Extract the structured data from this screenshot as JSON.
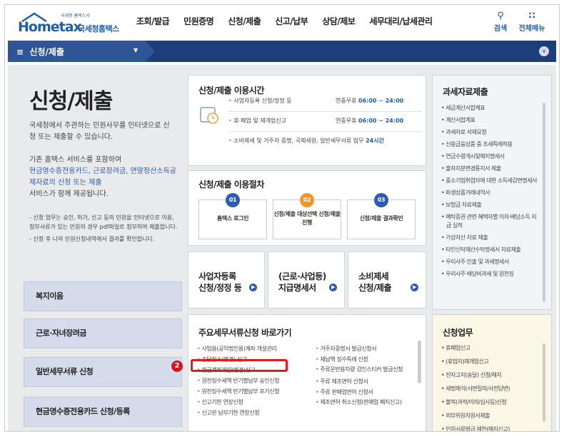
{
  "logo": {
    "text": "Hometax",
    "korean": "국세청홈택스",
    "tiny": "국세청 홈택스서"
  },
  "nav": [
    "조회/발급",
    "민원증명",
    "신청/제출",
    "신고/납부",
    "상담/제보",
    "세무대리/납세관리"
  ],
  "top_icons": {
    "search_label": "검색",
    "menu_label": "전체메뉴"
  },
  "subbar": {
    "label": "신청/제출"
  },
  "intro": {
    "title": "신청/제출",
    "p1": "국세청에서 주관하는 민원사무를 인터넷으로 신청 또는 제출할 수 있습니다.",
    "p2_a": "기존 홈택스 서비스를 포함하여",
    "p2_blue": "현금영수증전용카드, 근로장려금, 연말정산소득공제자료의 신청 또는 제출",
    "p2_b": "서비스가 함께 제공됩니다.",
    "note1": "- 신청 업무는 승인, 허가, 신고 등의 민원을 인터넷으로 이용, 첨부서류가 있는 민원의 경우 pdf파일로 첨부하여 제출합니다.",
    "note2": "- 신청 후 나의 민원신청내역에서 결과를 확인합니다."
  },
  "left_buttons": [
    "복지이음",
    "근로·자녀장려금",
    "일반세무서류 신청",
    "현금영수증전용카드 신청/등록"
  ],
  "time_box": {
    "title": "신청/제출 이용시간",
    "rows": [
      {
        "label": "사업자등록 신청/정정 등",
        "time_prefix": "연중무휴",
        "time": "06:00 ~ 24:00"
      },
      {
        "label": "휴·폐업 및 재개업신고",
        "time_prefix": "연중무휴",
        "time": "06:00 ~ 24:00"
      },
      {
        "label": "소비제세 및 거주자 증명, 국제세원, 일반세무서류 업무",
        "time_prefix": "",
        "time": "24시간"
      }
    ]
  },
  "proc_box": {
    "title": "신청/제출 이용절차",
    "steps": [
      {
        "num": "01",
        "label": "홈택스 로그인"
      },
      {
        "num": "02",
        "label": "신청/제출 대상선택 신청/제출 진행"
      },
      {
        "num": "03",
        "label": "신청/제출 결과확인"
      }
    ]
  },
  "quick": [
    {
      "line1": "사업자등록",
      "line2": "신청/정정 등"
    },
    {
      "line1": "(근로·사업등)",
      "line2": "지급명세서"
    },
    {
      "line1": "소비제세",
      "line2": "신청/제출"
    }
  ],
  "doc_box": {
    "title": "주요세무서류신청 바로가기",
    "col1": [
      "사업용(공익법인용)계좌 개설관리",
      "송달장소(변경) 신고",
      "환급계좌개설(변경)신고",
      "원천징수세액 반기별납부 승인신청",
      "원천징수세액 반기별납부 포기신청",
      "신고기한 연장신청",
      "신고분 납부기한 연장신청"
    ],
    "col2": [
      "거주자증명서 발급신청서",
      "체납액 징수특례 신청",
      "주류운반용차량 검인스티커 발급신청",
      "주류 제조면허 신청서",
      "주류 판매업면허 신청서",
      "제조면허 취소신청(판매업 폐지신고)"
    ],
    "badge": "2"
  },
  "tax_box": {
    "title": "과세자료제출",
    "items": [
      "세금계산서합계표",
      "계산서합계표",
      "과세자료 삭제요청",
      "신용금융상품 중 조세특례적용",
      "연금수령개시및해지명세서",
      "출자지분변경통지서 제출",
      "중소기업취업자에 대한 소득세감면명세서",
      "파생상품거래내역서",
      "보험금 자료제출",
      "예탁증권 관련 혜택자별 이자·배당소득 지급 실적",
      "가상자산 자료 제출",
      "타인신탁재산수탁명세서 자료제출",
      "우리사주 인출 및 과세명세서",
      "우리사주 배당비과세 및 원천징"
    ]
  },
  "apply_box": {
    "title": "신청업무",
    "items": [
      "휴폐업신고",
      "(휴업자)재개업신고",
      "전자고지(송달) 신청/해지",
      "세법해석(서면질의/사전답변)",
      "불복(과적/이의/심사등)신청",
      "외부위원지원서제출",
      "민원서류발급 제한(해지신고)"
    ]
  }
}
